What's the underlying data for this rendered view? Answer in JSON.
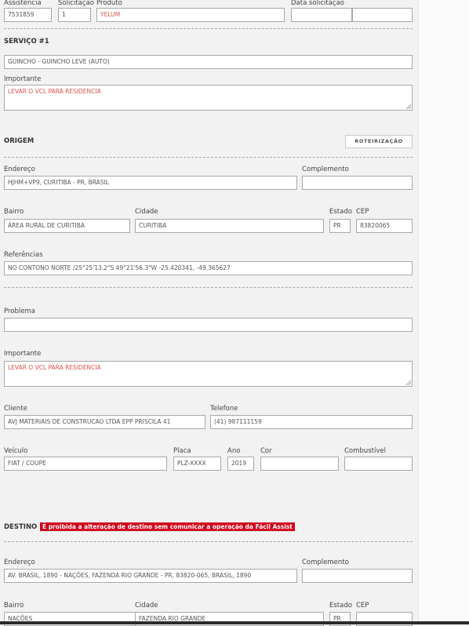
{
  "header": {
    "assistencia_label": "Assistência",
    "assistencia_value": "7531859",
    "solicitacao_label": "Solicitação",
    "solicitacao_value": "1",
    "produto_label": "Produto",
    "produto_value": "YELUM",
    "data_solicitacao_label": "Data solicitação",
    "data_solicitacao_value": "",
    "hora_solicitacao_value": ""
  },
  "servico": {
    "title": "SERVIÇO #1",
    "tipo_value": "GUINCHO - GUINCHO LEVE (AUTO)",
    "importante_label": "Importante",
    "importante_value": "LEVAR O VCL PARA RESIDENCIA"
  },
  "origem": {
    "title": "ORIGEM",
    "roteirizacao_label": "ROTEIRIZAÇÃO",
    "endereco_label": "Endereço",
    "endereco_value": "HJHM+VP9, CURITIBA - PR, BRASIL",
    "complemento_label": "Complemento",
    "complemento_value": "",
    "bairro_label": "Bairro",
    "bairro_value": "ÁREA RURAL DE CURITIBA",
    "cidade_label": "Cidade",
    "cidade_value": "CURITIBA",
    "estado_label": "Estado",
    "estado_value": "PR",
    "cep_label": "CEP",
    "cep_value": "83820065",
    "referencias_label": "Referências",
    "referencias_value": "NO CONTONO NORTE /25°25'13.2\"S 49°21'56.3\"W -25.420341, -49.365627"
  },
  "problema": {
    "problema_label": "Problema",
    "problema_value": "",
    "importante_label": "Importante",
    "importante_value": "LEVAR O VCL PARA RESIDENCIA"
  },
  "cliente": {
    "cliente_label": "Cliente",
    "cliente_value": "AVJ MATERIAIS DE CONSTRUCAO LTDA EPP   PRISCILA 41",
    "telefone_label": "Telefone",
    "telefone_value": "(41) 987111159"
  },
  "veiculo": {
    "veiculo_label": "Veículo",
    "veiculo_value": "FIAT / COUPE",
    "placa_label": "Placa",
    "placa_value": "PLZ-XXXX",
    "ano_label": "Ano",
    "ano_value": "2019",
    "cor_label": "Cor",
    "cor_value": "",
    "combustivel_label": "Combustível",
    "combustivel_value": ""
  },
  "destino": {
    "title": "DESTINO",
    "warning": "É proibida a alteração de destino sem comunicar a operação da Fácil Assist",
    "endereco_label": "Endereço",
    "endereco_value": "AV. BRASIL, 1890 - NAÇÕES, FAZENDA RIO GRANDE - PR, 83820-065, BRASIL, 1890",
    "complemento_label": "Complemento",
    "complemento_value": "",
    "bairro_label": "Bairro",
    "bairro_value": "NAÇÕES",
    "cidade_label": "Cidade",
    "cidade_value": "FAZENDA RIO GRANDE",
    "estado_label": "Estado",
    "estado_value": "PR",
    "cep_label": "CEP",
    "cep_value": ""
  },
  "colors": {
    "page_background": "#f2f2f2",
    "important_text": "#d9534f",
    "warning_badge": "#d0021b"
  }
}
